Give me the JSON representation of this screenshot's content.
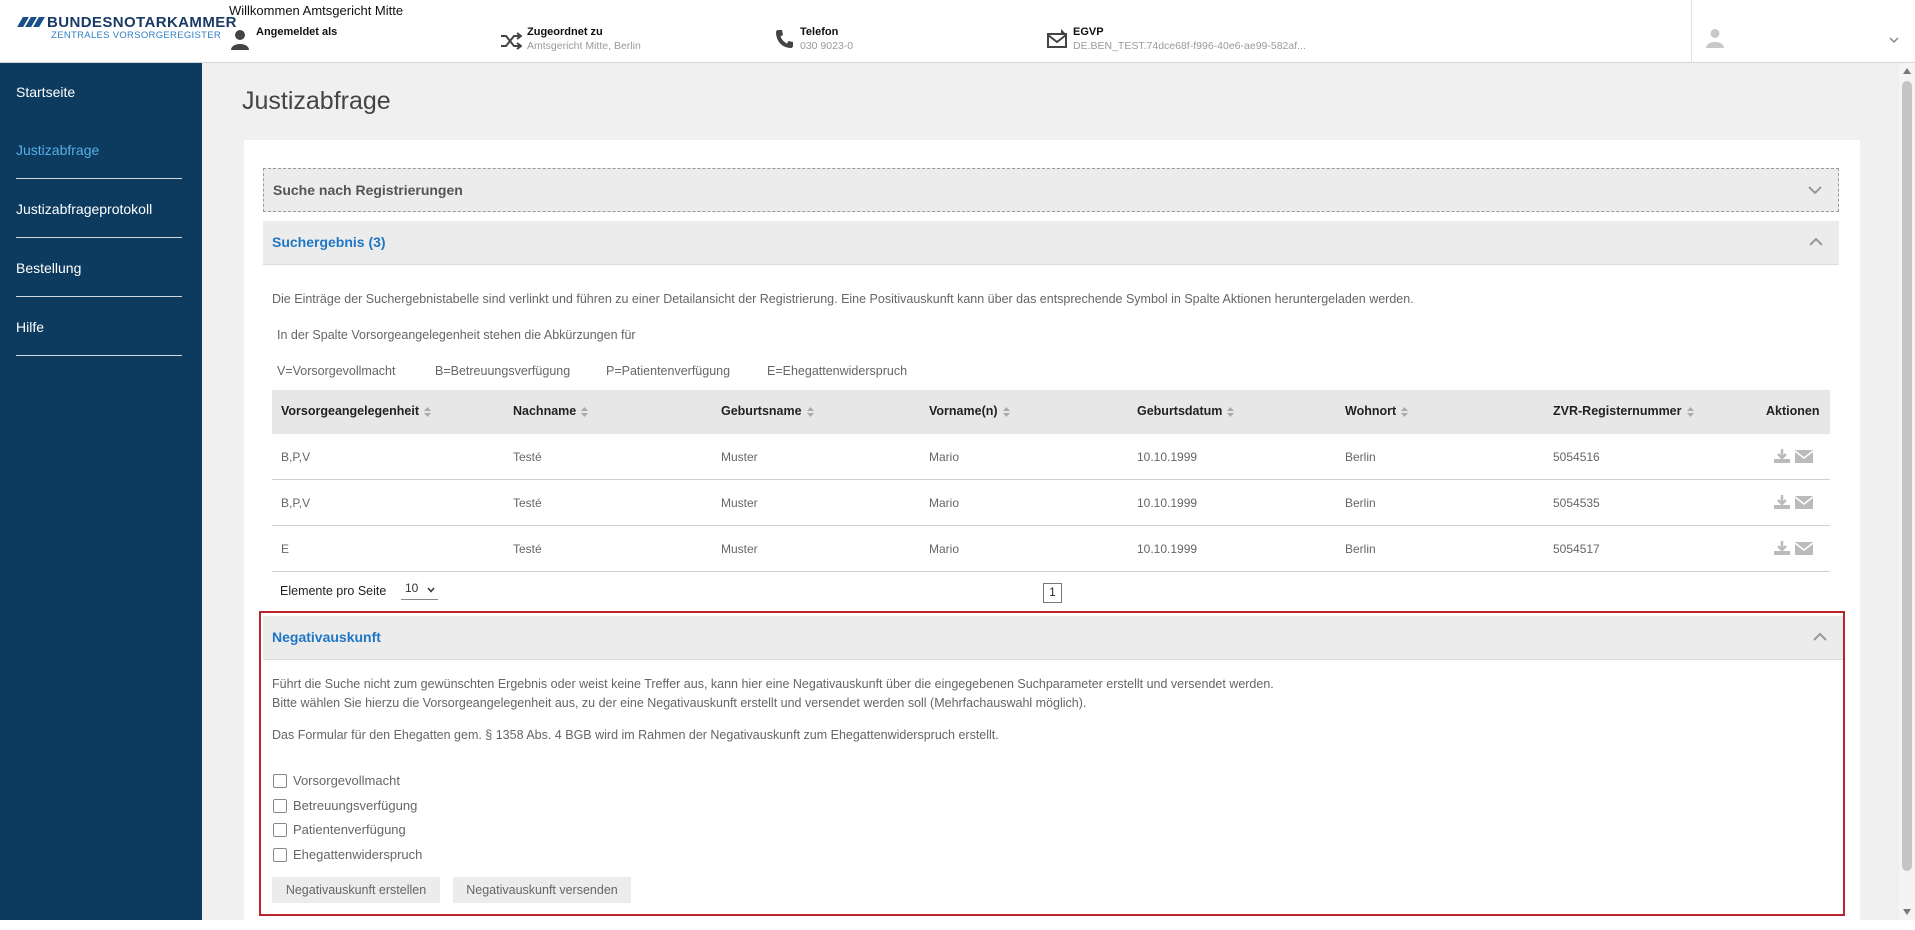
{
  "header": {
    "logo_name": "BUNDESNOTARKAMMER",
    "logo_sub": "ZENTRALES VORSORGEREGISTER",
    "welcome": "Willkommen Amtsgericht Mitte",
    "user": {
      "label": "Angemeldet als",
      "value": ""
    },
    "assigned": {
      "label": "Zugeordnet zu",
      "value": "Amtsgericht Mitte, Berlin"
    },
    "phone": {
      "label": "Telefon",
      "value": "030 9023-0"
    },
    "egvp": {
      "label": "EGVP",
      "value": "DE.BEN_TEST.74dce68f-f996-40e6-ae99-582af..."
    }
  },
  "sidebar": {
    "items": [
      {
        "label": "Startseite"
      },
      {
        "label": "Justizabfrage",
        "active": true
      },
      {
        "label": "Justizabfrageprotokoll"
      },
      {
        "label": "Bestellung"
      },
      {
        "label": "Hilfe"
      }
    ]
  },
  "page": {
    "title": "Justizabfrage"
  },
  "search_panel": {
    "title": "Suche nach Registrierungen"
  },
  "results": {
    "title": "Suchergebnis (3)",
    "info": "Die Einträge der Suchergebnistabelle sind verlinkt und führen zu einer Detailansicht der Registrierung. Eine Positivauskunft kann über das entsprechende Symbol in Spalte Aktionen heruntergeladen werden.",
    "abbr_intro": "In der Spalte Vorsorgeangelegenheit stehen die Abkürzungen für",
    "abbr": [
      "V=Vorsorgevollmacht",
      "B=Betreuungsverfügung",
      "P=Patientenverfügung",
      "E=Ehegattenwiderspruch"
    ],
    "columns": [
      "Vorsorgeangelegenheit",
      "Nachname",
      "Geburtsname",
      "Vorname(n)",
      "Geburtsdatum",
      "Wohnort",
      "ZVR-Registernummer",
      "Aktionen"
    ],
    "rows": [
      [
        "B,P,V",
        "Testé",
        "Muster",
        "Mario",
        "10.10.1999",
        "Berlin",
        "5054516"
      ],
      [
        "B,P,V",
        "Testé",
        "Muster",
        "Mario",
        "10.10.1999",
        "Berlin",
        "5054535"
      ],
      [
        "E",
        "Testé",
        "Muster",
        "Mario",
        "10.10.1999",
        "Berlin",
        "5054517"
      ]
    ],
    "page_size_label": "Elemente pro Seite",
    "page_size": "10",
    "page": "1"
  },
  "negative": {
    "title": "Negativauskunft",
    "line1": "Führt die Suche nicht zum gewünschten Ergebnis oder weist keine Treffer aus, kann hier eine Negativauskunft über die eingegebenen Suchparameter erstellt und versendet werden.",
    "line2": "Bitte wählen Sie hierzu die Vorsorgeangelegenheit aus, zu der eine Negativauskunft erstellt und versendet werden soll (Mehrfachauswahl möglich).",
    "line3": "Das Formular für den Ehegatten gem. § 1358 Abs. 4 BGB wird im Rahmen der Negativauskunft zum Ehegattenwiderspruch erstellt.",
    "options": [
      "Vorsorgevollmacht",
      "Betreuungsverfügung",
      "Patientenverfügung",
      "Ehegattenwiderspruch"
    ],
    "create_label": "Negativauskunft erstellen",
    "send_label": "Negativauskunft versenden"
  },
  "colors": {
    "sidebar": "#0d3a5f",
    "accent": "#1f77c3",
    "active_nav": "#57aee8",
    "highlight_border": "#b9252b"
  }
}
